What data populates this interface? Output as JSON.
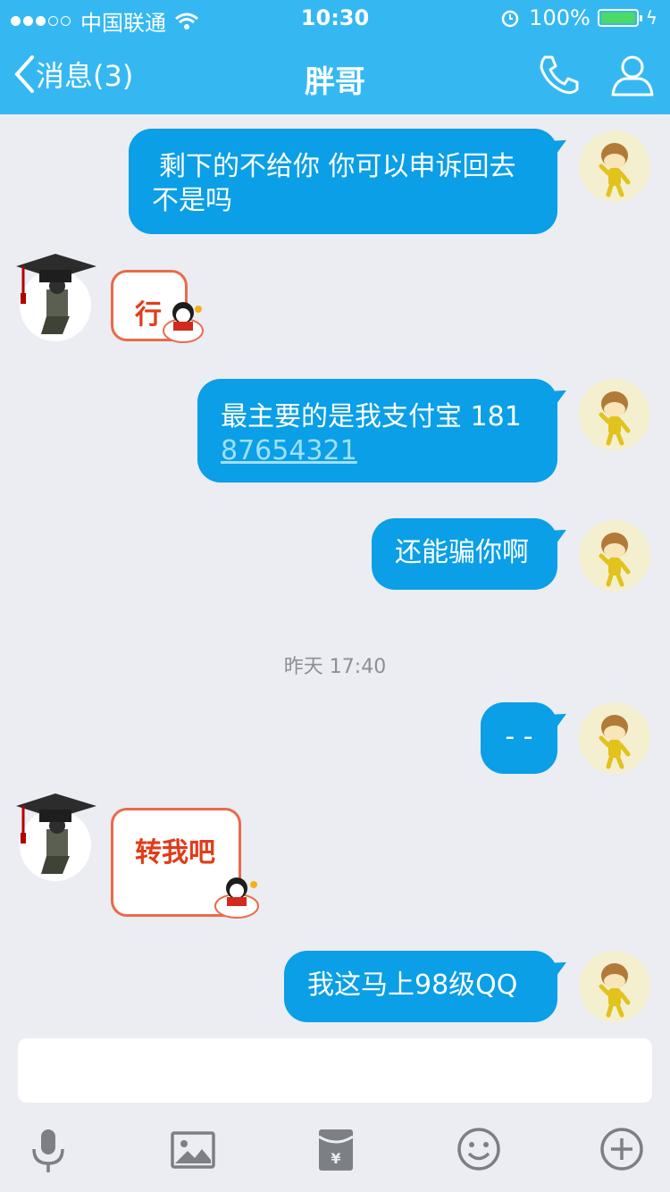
{
  "status_bar": {
    "carrier": "中国联通",
    "time": "10:30",
    "battery": "100%"
  },
  "nav": {
    "back_label": "消息(3)",
    "title": "胖哥"
  },
  "messages": [
    {
      "side": "right",
      "lines": [
        "剩下的不给你 你可以申诉回去",
        "不是吗"
      ]
    },
    {
      "side": "left",
      "text": "行"
    },
    {
      "side": "right",
      "line1": "最主要的是我支付宝 181",
      "link": "87654321"
    },
    {
      "side": "right",
      "text": "还能骗你啊"
    },
    {
      "side": "right",
      "text": "- -"
    },
    {
      "side": "left",
      "text": "转我吧"
    },
    {
      "side": "right",
      "text": "我这马上98级QQ"
    }
  ],
  "timestamp": "昨天 17:40",
  "colors": {
    "header": "#35b8f2",
    "bubble_right": "#0a9fe6",
    "bubble_left_border": "#ea6a4a",
    "bubble_left_text": "#e03c1a",
    "background": "#ebedf2"
  },
  "toolbar": [
    "microphone-icon",
    "image-icon",
    "red-envelope-icon",
    "emoji-icon",
    "plus-icon"
  ]
}
